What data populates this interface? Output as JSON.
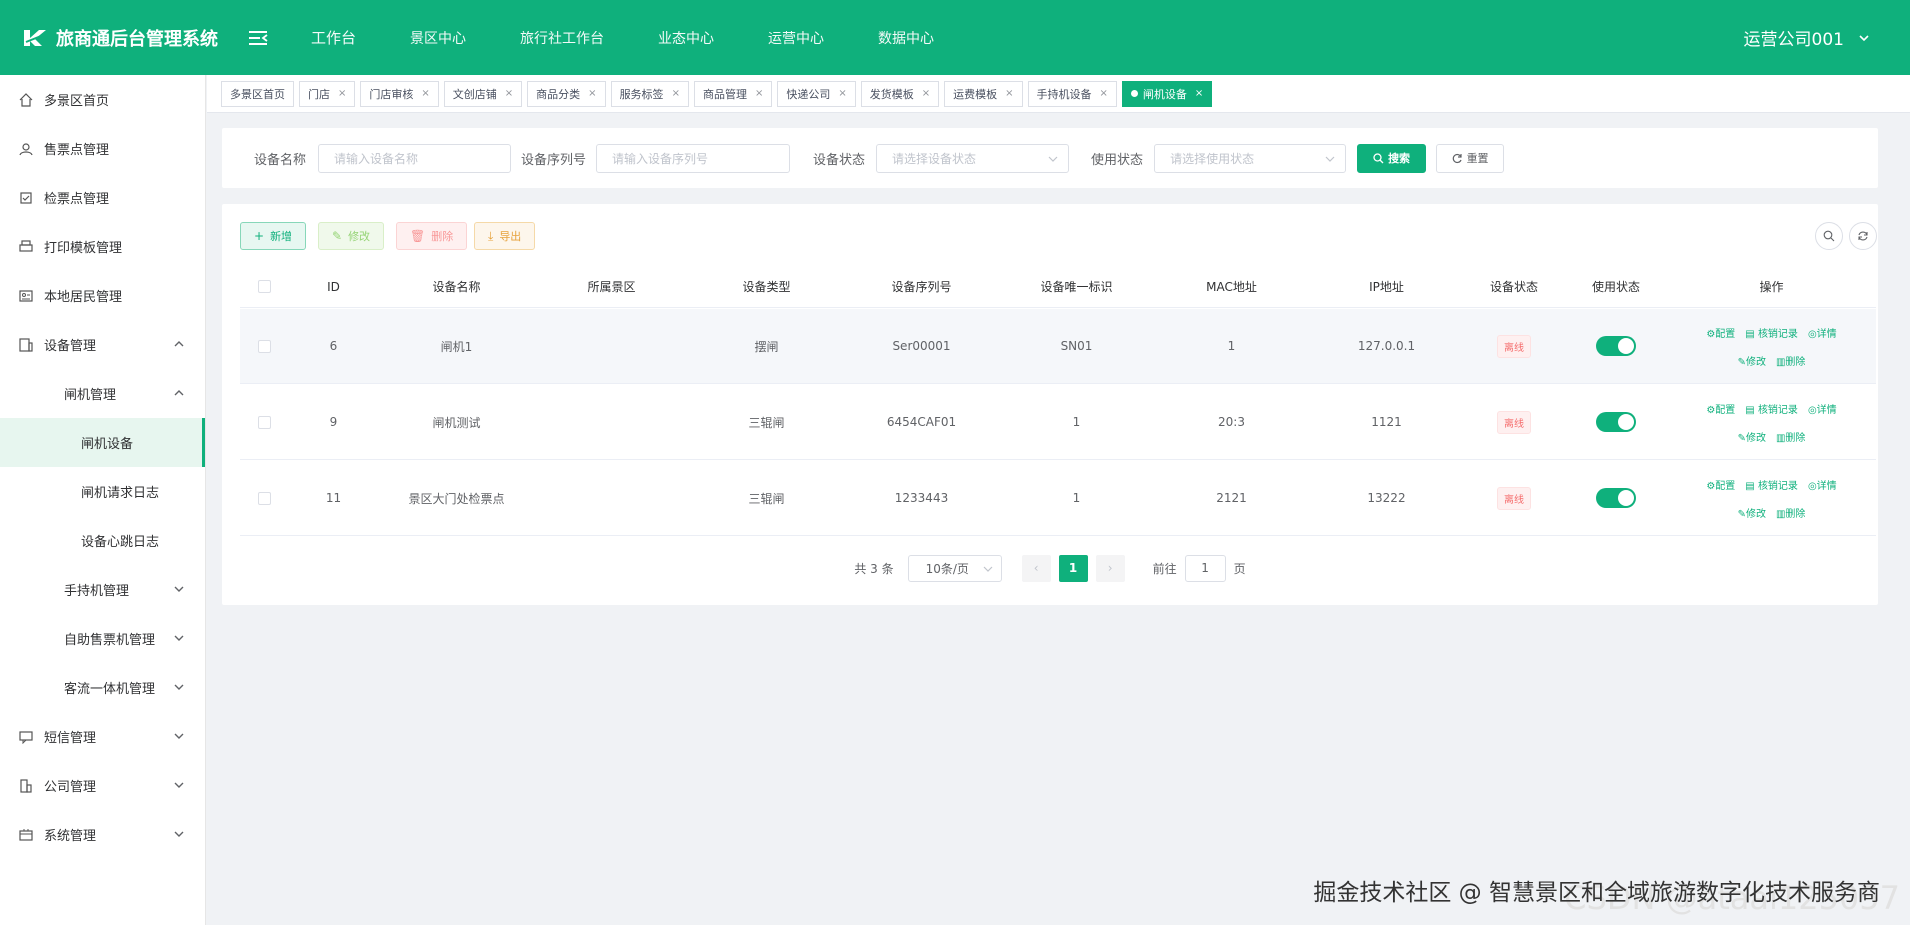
{
  "app": {
    "title": "旅商通后台管理系统"
  },
  "topnav": [
    "工作台",
    "景区中心",
    "旅行社工作台",
    "业态中心",
    "运营中心",
    "数据中心"
  ],
  "user": {
    "name": "运营公司001"
  },
  "sidebar": [
    {
      "label": "多景区首页",
      "icon": "home-icon"
    },
    {
      "label": "售票点管理",
      "icon": "user-icon"
    },
    {
      "label": "检票点管理",
      "icon": "checkin-icon"
    },
    {
      "label": "打印模板管理",
      "icon": "print-icon"
    },
    {
      "label": "本地居民管理",
      "icon": "id-card-icon"
    },
    {
      "label": "设备管理",
      "icon": "device-icon"
    },
    {
      "label": "闸机管理"
    },
    {
      "label": "闸机设备"
    },
    {
      "label": "闸机请求日志"
    },
    {
      "label": "设备心跳日志"
    },
    {
      "label": "手持机管理"
    },
    {
      "label": "自助售票机管理"
    },
    {
      "label": "客流一体机管理"
    },
    {
      "label": "短信管理",
      "icon": "message-icon"
    },
    {
      "label": "公司管理",
      "icon": "company-icon"
    },
    {
      "label": "系统管理",
      "icon": "system-icon"
    }
  ],
  "tabs": [
    "多景区首页",
    "门店",
    "门店审核",
    "文创店铺",
    "商品分类",
    "服务标签",
    "商品管理",
    "快递公司",
    "发货模板",
    "运费模板",
    "手持机设备",
    "闸机设备"
  ],
  "search": {
    "device_name_label": "设备名称",
    "device_name_placeholder": "请输入设备名称",
    "serial_label": "设备序列号",
    "serial_placeholder": "请输入设备序列号",
    "status_label": "设备状态",
    "status_placeholder": "请选择设备状态",
    "use_label": "使用状态",
    "use_placeholder": "请选择使用状态",
    "search_btn": "搜索",
    "reset_btn": "重置"
  },
  "toolbar": {
    "add": "新增",
    "edit": "修改",
    "delete": "删除",
    "export": "导出"
  },
  "table": {
    "columns": [
      "ID",
      "设备名称",
      "所属景区",
      "设备类型",
      "设备序列号",
      "设备唯一标识",
      "MAC地址",
      "IP地址",
      "设备状态",
      "使用状态",
      "操作"
    ],
    "rows": [
      {
        "id": "6",
        "name": "闸机1",
        "scenic": "",
        "type": "摆闸",
        "serial": "Ser00001",
        "uid": "SN01",
        "mac": "1",
        "ip": "127.0.0.1",
        "status": "离线",
        "enabled": true
      },
      {
        "id": "9",
        "name": "闸机测试",
        "scenic": "",
        "type": "三辊闸",
        "serial": "6454CAF01",
        "uid": "1",
        "mac": "20:3",
        "ip": "1121",
        "status": "离线",
        "enabled": true
      },
      {
        "id": "11",
        "name": "景区大门处检票点",
        "scenic": "",
        "type": "三辊闸",
        "serial": "1233443",
        "uid": "1",
        "mac": "2121",
        "ip": "13222",
        "status": "离线",
        "enabled": true
      }
    ],
    "ops": {
      "config": "配置",
      "verify": "核销记录",
      "detail": "详情",
      "edit": "修改",
      "delete": "删除"
    }
  },
  "pager": {
    "total": "共 3 条",
    "size": "10条/页",
    "current": "1",
    "goto_label": "前往",
    "goto_value": "1",
    "page_unit": "页"
  },
  "watermark": {
    "text": "掘金技术社区 @ 智慧景区和全域旅游数字化技术服务商",
    "ghost": "CSDN @ataai125057"
  },
  "colors": {
    "primary": "#0fb07c",
    "danger": "#f56c6c",
    "warning": "#e6a23c"
  }
}
